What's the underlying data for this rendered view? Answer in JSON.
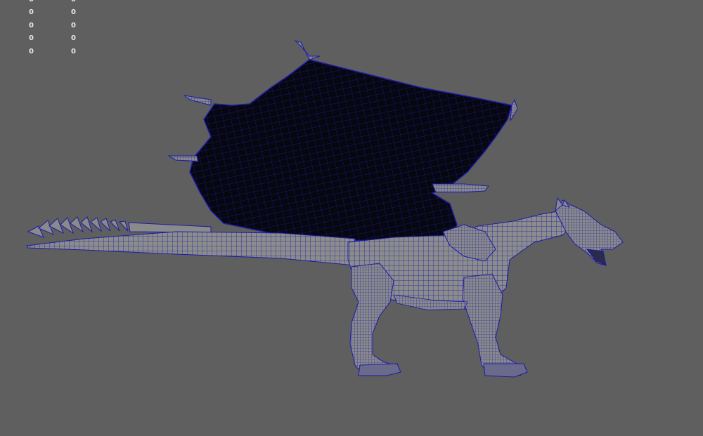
{
  "viewport": {
    "background_color": "#5f5f5f",
    "wire_color": "#1c1ca8",
    "body_shade": "#8a8a8a",
    "wing_shade": "#0a0a14",
    "subject": "dragon-wireframe-mesh"
  },
  "hud": {
    "rows": [
      {
        "a": "0",
        "b": "0"
      },
      {
        "a": "0",
        "b": "0"
      },
      {
        "a": "0",
        "b": "0"
      },
      {
        "a": "0",
        "b": "0"
      },
      {
        "a": "0",
        "b": "0"
      }
    ]
  }
}
